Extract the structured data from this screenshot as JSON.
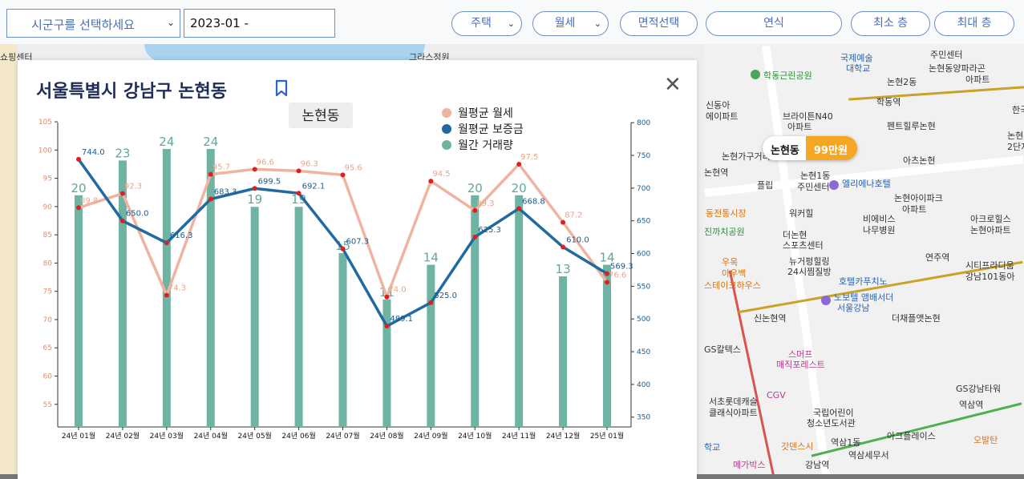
{
  "toolbar": {
    "district_select": "시군구를 선택하세요",
    "date_value": "2023-01 -",
    "housing_type": "주택",
    "deal_type": "월세",
    "area_button": "면적선택",
    "year_button": "연식",
    "min_floor_button": "최소 층",
    "max_floor_button": "최대 층"
  },
  "map": {
    "labels_left": [
      "그라스정원",
      "쇼핑센터"
    ],
    "labels_right": [
      "국제예술",
      "대학교",
      "학동근린공원",
      "논현2동",
      "학동역",
      "신동아",
      "에이파트",
      "브라이튼N40",
      "아파트",
      "논현가구거리",
      "펜트힐루논현",
      "아츠논현",
      "논현1동",
      "주민센터",
      "엘리에나호텔",
      "플립",
      "논현아이파크",
      "아파트",
      "논현역",
      "워커힐",
      "비에비스",
      "나무병원",
      "아크로힐스",
      "논현아파트",
      "동전통시장",
      "더논현",
      "스포츠센터",
      "연주역",
      "뉴거펑힐링",
      "24시찜질방",
      "호텔카푸치노",
      "시티프라디움",
      "강남101동아",
      "스테이크하우스",
      "노보텔 앰배서더",
      "서울강남",
      "신논현역",
      "더채플앳논현",
      "GS칼텍스",
      "스머프",
      "매직포레스트",
      "서초롯데캐슬",
      "클래식아파트",
      "CGV",
      "국립어린이",
      "청소년도서관",
      "GS강남타워",
      "역삼역",
      "아크플레이스",
      "역삼1동",
      "역삼세무서",
      "강남역",
      "메가박스",
      "오발탄",
      "한국",
      "논현동",
      "2단지",
      "주민센터",
      "논현동양파라곤",
      "아파트",
      "우옥",
      "아우백",
      "진까치공원",
      "갓덴스시",
      "학교"
    ],
    "price_badge": {
      "name": "논현동",
      "price": "99만원"
    }
  },
  "panel": {
    "title": "서울특별시 강남구 논현동",
    "close_label": "✕"
  },
  "chart_data": {
    "type": "bar",
    "title": "논현동",
    "categories": [
      "24년 01월",
      "24년 02월",
      "24년 03월",
      "24년 04월",
      "24년 05월",
      "24년 06월",
      "24년 07월",
      "24년 08월",
      "24년 09월",
      "24년 10월",
      "24년 11월",
      "24년 12월",
      "25년 01월"
    ],
    "legend": [
      "월평균 월세",
      "월평균 보증금",
      "월간 거래량"
    ],
    "colors": {
      "rent": "#f0b3a0",
      "deposit": "#1f6aa0",
      "volume": "#6fb3a3",
      "point": "#e02020"
    },
    "series": [
      {
        "name": "월평균 월세",
        "axis": "left",
        "type": "line",
        "values": [
          89.8,
          92.3,
          74.3,
          95.7,
          96.6,
          96.3,
          95.6,
          74.0,
          94.5,
          89.3,
          97.5,
          87.2,
          76.6
        ]
      },
      {
        "name": "월평균 보증금",
        "axis": "right",
        "type": "line",
        "values": [
          744.0,
          650.0,
          616.3,
          683.3,
          699.5,
          692.1,
          607.3,
          489.1,
          525.0,
          625.3,
          668.8,
          610.0,
          569.3
        ]
      },
      {
        "name": "월간 거래량",
        "axis": "left",
        "type": "bar",
        "values": [
          20,
          23,
          24,
          24,
          19,
          19,
          15,
          11,
          14,
          20,
          20,
          13,
          14
        ]
      }
    ],
    "rent_labels": [
      "89.8",
      "92.3",
      "74.3",
      "95.7",
      "96.6",
      "96.3",
      "95.6",
      "74.0",
      "94.5",
      "89.3",
      "97.5",
      "87.2",
      "76.6"
    ],
    "deposit_labels": [
      "744.0",
      "650.0",
      "616.3",
      "683.3",
      "699.5",
      "692.1",
      "607.3",
      "489.1",
      "525.0",
      "625.3",
      "668.8",
      "610.0",
      "569.3"
    ],
    "left_ticks": [
      "105",
      "100",
      "95",
      "90",
      "85",
      "80",
      "75",
      "70",
      "65",
      "60",
      "55"
    ],
    "right_ticks": [
      "800",
      "750",
      "700",
      "650",
      "600",
      "550",
      "500",
      "450",
      "400",
      "350"
    ],
    "ylim_left": [
      51,
      106
    ],
    "ylim_right": [
      335,
      810
    ],
    "bar_ylim": [
      0,
      24
    ]
  }
}
